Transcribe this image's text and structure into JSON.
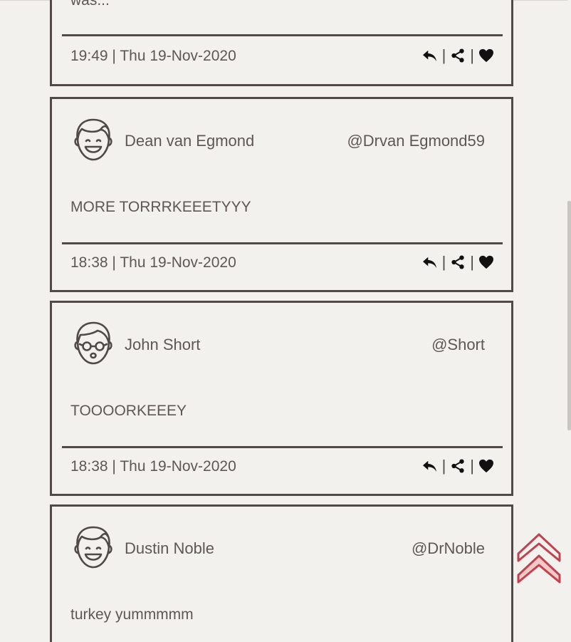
{
  "posts": [
    {
      "message": "was...",
      "time": "19:49",
      "date_sep": "|",
      "date": "Thu 19-Nov-2020"
    },
    {
      "name": "Dean van Egmond",
      "handle": "@Drvan Egmond59",
      "message": "MORE TORRRKEEETYYY",
      "time": "18:38",
      "date_sep": "|",
      "date": "Thu 19-Nov-2020",
      "avatar": "smiling-face-icon"
    },
    {
      "name": "John Short",
      "handle": "@Short",
      "message": "TOOOORKEEEY",
      "time": "18:38",
      "date_sep": "|",
      "date": "Thu 19-Nov-2020",
      "avatar": "glasses-face-icon"
    },
    {
      "name": "Dustin Noble",
      "handle": "@DrNoble",
      "message": "turkey yummmmm",
      "avatar": "smiling-face-icon"
    }
  ],
  "actions": {
    "reply": "reply-icon",
    "share": "share-icon",
    "like": "heart-icon",
    "separator": "|"
  },
  "colors": {
    "background": "#f3f1ed",
    "border": "#504a46",
    "text": "#5e5753",
    "back_to_top": "#c0424f"
  },
  "back_to_top": "double-chevron-up-icon"
}
